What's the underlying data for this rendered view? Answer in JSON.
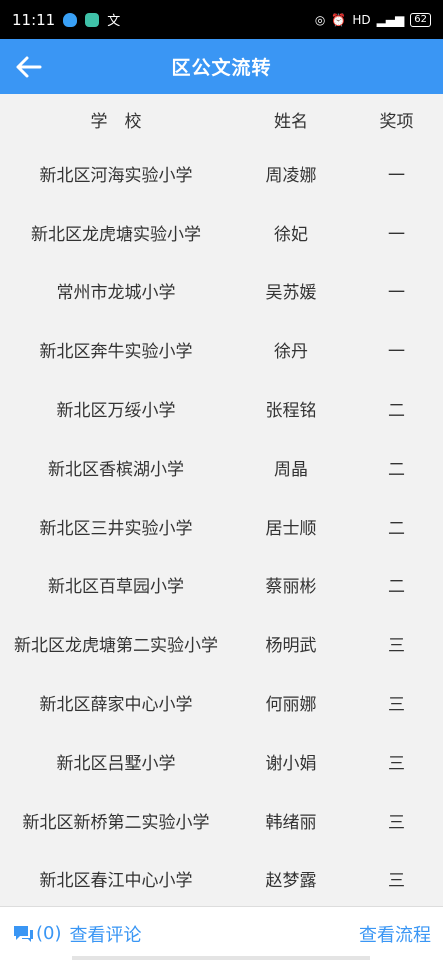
{
  "statusbar": {
    "time": "11:11",
    "network": "HD",
    "battery": "62"
  },
  "header": {
    "title": "区公文流转"
  },
  "table": {
    "columns": [
      "学　校",
      "姓名",
      "奖项"
    ],
    "rows": [
      [
        "新北区河海实验小学",
        "周凌娜",
        "一"
      ],
      [
        "新北区龙虎塘实验小学",
        "徐妃",
        "一"
      ],
      [
        "常州市龙城小学",
        "吴苏媛",
        "一"
      ],
      [
        "新北区奔牛实验小学",
        "徐丹",
        "一"
      ],
      [
        "新北区万绥小学",
        "张程铭",
        "二"
      ],
      [
        "新北区香槟湖小学",
        "周晶",
        "二"
      ],
      [
        "新北区三井实验小学",
        "居士顺",
        "二"
      ],
      [
        "新北区百草园小学",
        "蔡丽彬",
        "二"
      ],
      [
        "新北区龙虎塘第二实验小学",
        "杨明武",
        "三"
      ],
      [
        "新北区薛家中心小学",
        "何丽娜",
        "三"
      ],
      [
        "新北区吕墅小学",
        "谢小娟",
        "三"
      ],
      [
        "新北区新桥第二实验小学",
        "韩绪丽",
        "三"
      ],
      [
        "新北区春江中心小学",
        "赵梦露",
        "三"
      ]
    ]
  },
  "footer": {
    "comment_count": "(0)",
    "comment_label": "查看评论",
    "flow_label": "查看流程"
  },
  "colors": {
    "accent": "#3a96f4"
  }
}
